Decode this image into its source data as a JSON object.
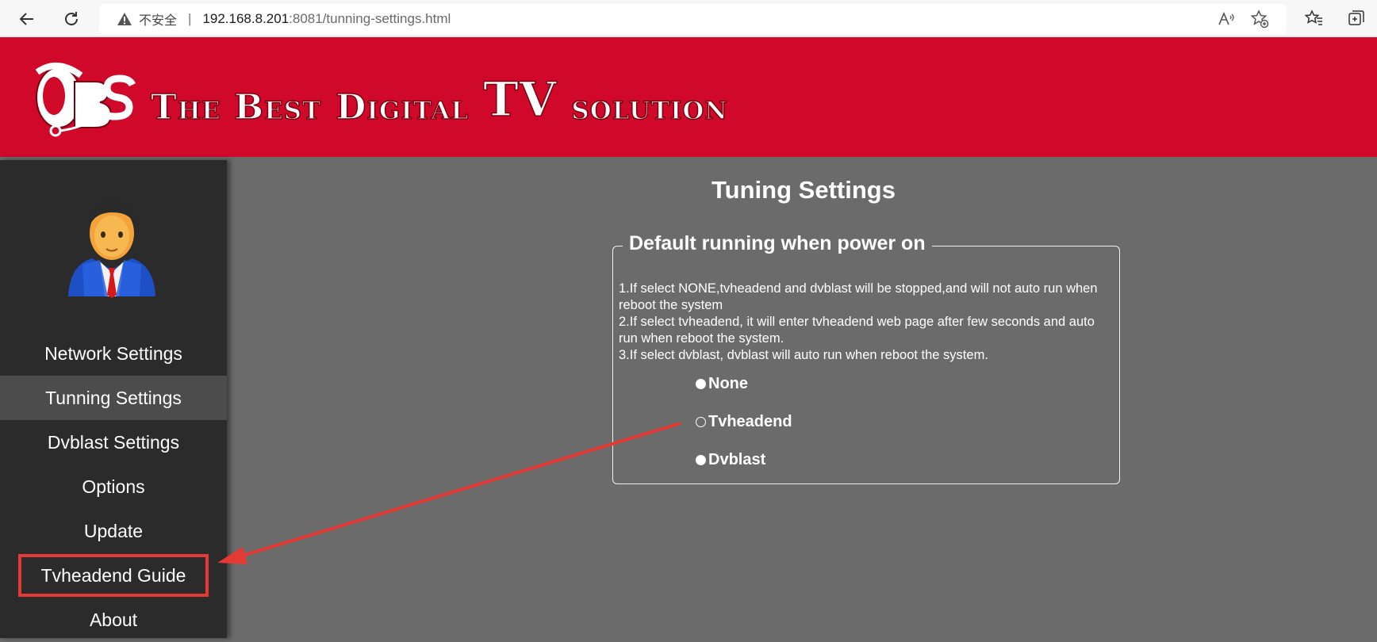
{
  "browser": {
    "insecure_label": "不安全",
    "separator": "|",
    "url_host": "192.168.8.201",
    "url_rest": ":8081/tunning-settings.html"
  },
  "header": {
    "logo_letters": "TBS",
    "tagline_words": [
      "The Best",
      "Digital",
      "TV",
      "solution"
    ]
  },
  "sidebar": {
    "items": [
      {
        "label": "Network Settings"
      },
      {
        "label": "Tunning Settings"
      },
      {
        "label": "Dvblast Settings"
      },
      {
        "label": "Options"
      },
      {
        "label": "Update"
      },
      {
        "label": "Tvheadend Guide"
      },
      {
        "label": "About"
      }
    ],
    "active": "Tunning Settings",
    "highlighted": "Tvheadend Guide"
  },
  "main": {
    "title": "Tuning Settings",
    "fieldset_legend": "Default running when power on",
    "description": [
      "1.If select NONE,tvheadend and dvblast will be stopped,and will not auto run when reboot the system",
      "2.If select tvheadend, it will enter tvheadend web page after few seconds and auto run when reboot the system.",
      "3.If select dvblast, dvblast will auto run when reboot the system."
    ],
    "options": [
      {
        "label": "None",
        "selected": false
      },
      {
        "label": "Tvheadend",
        "selected": false
      },
      {
        "label": "Dvblast",
        "selected": false
      }
    ]
  },
  "colors": {
    "header_red": "#d0082a",
    "sidebar_bg": "#2b2b2b",
    "content_bg": "#6b6b6b",
    "annotation_red": "#e53935"
  }
}
